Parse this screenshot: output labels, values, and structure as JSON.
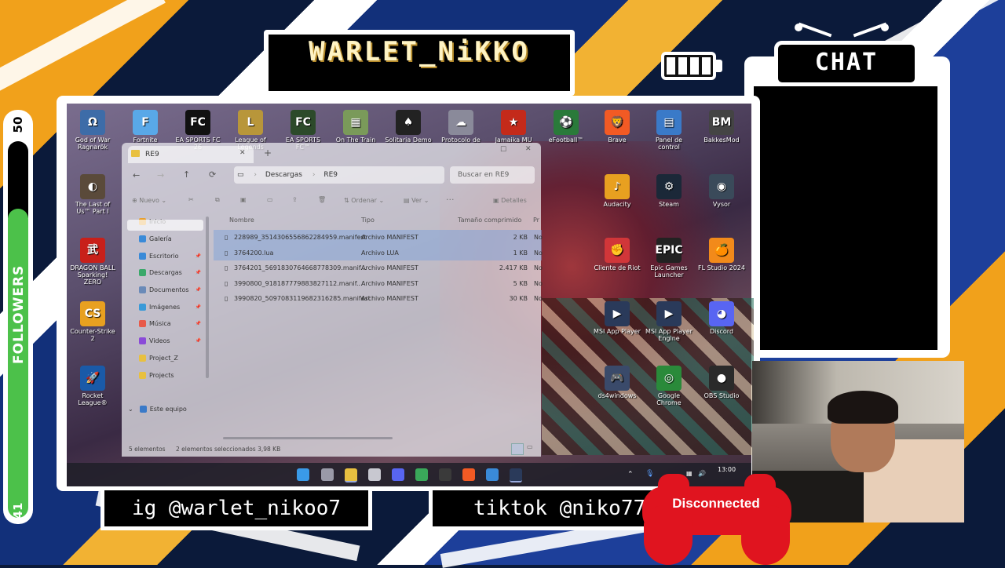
{
  "overlay": {
    "streamer_name": "WARLET_NiKKO",
    "chat_title": "CHAT",
    "followers_label": "FOLLOWERS",
    "followers_goal": "50",
    "followers_count": "41",
    "followers_progress": 0.82,
    "instagram": "ig @warlet_nikoo7",
    "tiktok": "tiktok @niko7789",
    "controller_status": "Disconnected",
    "colors": {
      "accent_green": "#4cc14a",
      "controller_red": "#e0141f",
      "frame": "#ffffff"
    }
  },
  "desktop": {
    "icons": [
      {
        "label": "God of War Ragnarök",
        "icon": "god-of-war-icon",
        "color": "#3d6ca8",
        "glyph": "Ω"
      },
      {
        "label": "Fortnite",
        "icon": "fortnite-icon",
        "color": "#59a8e8",
        "glyph": "F"
      },
      {
        "label": "EA SPORTS FC 26",
        "icon": "fc26-icon",
        "color": "#111111",
        "glyph": "FC"
      },
      {
        "label": "League of Legends",
        "icon": "league-icon",
        "color": "#b8963a",
        "glyph": "L"
      },
      {
        "label": "EA SPORTS FC™",
        "icon": "fc-icon",
        "color": "#2c4a2a",
        "glyph": "FC"
      },
      {
        "label": "On The Train",
        "icon": "on-the-train-icon",
        "color": "#7a9a5a",
        "glyph": "▦"
      },
      {
        "label": "Solitaria Demo",
        "icon": "solitaria-icon",
        "color": "#222222",
        "glyph": "♠"
      },
      {
        "label": "Protocolo de",
        "icon": "protocolo-icon",
        "color": "#8a8a9a",
        "glyph": "☁"
      },
      {
        "label": "Jamaika MU",
        "icon": "jamaika-icon",
        "color": "#c42a1a",
        "glyph": "★"
      },
      {
        "label": "eFootball™",
        "icon": "efootball-icon",
        "color": "#2a7a3a",
        "glyph": "⚽"
      },
      {
        "label": "Brave",
        "icon": "brave-icon",
        "color": "#f25a24",
        "glyph": "🦁"
      },
      {
        "label": "Panel de control",
        "icon": "control-panel-icon",
        "color": "#3a7ac8",
        "glyph": "▤"
      },
      {
        "label": "BakkesMod",
        "icon": "bakkesmod-icon",
        "color": "#444444",
        "glyph": "BM"
      },
      {
        "label": "The Last of Us™ Part I",
        "icon": "last-of-us-icon",
        "color": "#5a4a3a",
        "glyph": "◐"
      },
      {
        "label": "Audacity",
        "icon": "audacity-icon",
        "color": "#e8a020",
        "glyph": "♪"
      },
      {
        "label": "Steam",
        "icon": "steam-icon",
        "color": "#1b2838",
        "glyph": "⚙"
      },
      {
        "label": "Vysor",
        "icon": "vysor-icon",
        "color": "#3a4a5a",
        "glyph": "◉"
      },
      {
        "label": "DRAGON BALL Sparking! ZERO",
        "icon": "dragon-ball-icon",
        "color": "#c8201a",
        "glyph": "武"
      },
      {
        "label": "Cliente de Riot",
        "icon": "riot-client-icon",
        "color": "#d13639",
        "glyph": "✊"
      },
      {
        "label": "Epic Games Launcher",
        "icon": "epic-games-icon",
        "color": "#222222",
        "glyph": "EPIC"
      },
      {
        "label": "FL Studio 2024",
        "icon": "fl-studio-icon",
        "color": "#f28a1a",
        "glyph": "🍊"
      },
      {
        "label": "Counter-Strike 2",
        "icon": "counter-strike-icon",
        "color": "#e8a020",
        "glyph": "CS"
      },
      {
        "label": "MSI App Player",
        "icon": "msi-app-player-icon",
        "color": "#2a3a5a",
        "glyph": "▶"
      },
      {
        "label": "MSI App Player Engine",
        "icon": "msi-engine-icon",
        "color": "#2a3a5a",
        "glyph": "▶"
      },
      {
        "label": "Discord",
        "icon": "discord-icon",
        "color": "#5865f2",
        "glyph": "◕"
      },
      {
        "label": "Rocket League®",
        "icon": "rocket-league-icon",
        "color": "#1a5aa8",
        "glyph": "🚀"
      },
      {
        "label": "ds4windows",
        "icon": "ds4-icon",
        "color": "#3a4a6a",
        "glyph": "🎮"
      },
      {
        "label": "Google Chrome",
        "icon": "chrome-icon",
        "color": "#2a8a3a",
        "glyph": "◎"
      },
      {
        "label": "OBS Studio",
        "icon": "obs-icon",
        "color": "#2a2a2a",
        "glyph": "●"
      }
    ]
  },
  "explorer": {
    "tab_title": "RE9",
    "add_tab": "+",
    "breadcrumb": [
      "Descargas",
      "RE9"
    ],
    "search_placeholder": "Buscar en RE9",
    "toolbar": {
      "new": "Nuevo",
      "sort": "Ordenar",
      "view": "Ver",
      "more": "···",
      "details": "Detalles"
    },
    "nav": [
      {
        "label": "Inicio",
        "icon": "home-icon",
        "color": "#e8a030"
      },
      {
        "label": "Galería",
        "icon": "gallery-icon",
        "color": "#3a8ad8"
      },
      {
        "label": "Escritorio",
        "icon": "desktop-folder-icon",
        "color": "#3a8ad8"
      },
      {
        "label": "Descargas",
        "icon": "downloads-icon",
        "color": "#3aa86a"
      },
      {
        "label": "Documentos",
        "icon": "documents-icon",
        "color": "#6a8ab8"
      },
      {
        "label": "Imágenes",
        "icon": "pictures-icon",
        "color": "#3a9ad8"
      },
      {
        "label": "Música",
        "icon": "music-icon",
        "color": "#e85a4a"
      },
      {
        "label": "Videos",
        "icon": "videos-icon",
        "color": "#8a4ad8"
      },
      {
        "label": "Project_Z",
        "icon": "folder-icon",
        "color": "#e8c040"
      },
      {
        "label": "Projects",
        "icon": "folder-icon",
        "color": "#e8c040"
      },
      {
        "label": "",
        "icon": "",
        "color": "transparent"
      },
      {
        "label": "Este equipo",
        "icon": "this-pc-icon",
        "color": "#3a7ac8"
      }
    ],
    "columns": {
      "name": "Nombre",
      "type": "Tipo",
      "size": "Tamaño comprimido",
      "extra": "Pr"
    },
    "files": [
      {
        "name": "228989_3514306556862284959.manifest",
        "type": "Archivo MANIFEST",
        "size": "2 KB",
        "extra": "No",
        "selected": true
      },
      {
        "name": "3764200.lua",
        "type": "Archivo LUA",
        "size": "1 KB",
        "extra": "No",
        "selected": true
      },
      {
        "name": "3764201_5691830764668778309.manif...",
        "type": "Archivo MANIFEST",
        "size": "2.417 KB",
        "extra": "No",
        "selected": false
      },
      {
        "name": "3990800_918187779883827112.manif...",
        "type": "Archivo MANIFEST",
        "size": "5 KB",
        "extra": "No",
        "selected": false
      },
      {
        "name": "3990820_5097083119682316285.manifest",
        "type": "Archivo MANIFEST",
        "size": "30 KB",
        "extra": "No",
        "selected": false
      }
    ],
    "status": {
      "count": "5 elementos",
      "selection": "2 elementos seleccionados  3,98 KB"
    }
  },
  "taskbar": {
    "icons": [
      {
        "icon": "windows-start-icon",
        "color": "#3a9ae8"
      },
      {
        "icon": "task-view-icon",
        "color": "#9a9aa8"
      },
      {
        "icon": "file-explorer-icon",
        "color": "#e8c040"
      },
      {
        "icon": "store-icon",
        "color": "#c8c8d0"
      },
      {
        "icon": "discord-icon",
        "color": "#5865f2"
      },
      {
        "icon": "chrome-icon",
        "color": "#3aa85a"
      },
      {
        "icon": "obs-icon",
        "color": "#3a3a3a"
      },
      {
        "icon": "brave-icon",
        "color": "#f25a24"
      },
      {
        "icon": "photos-icon",
        "color": "#3a8ad8"
      },
      {
        "icon": "steam-icon",
        "color": "#2a3a5a"
      }
    ],
    "clock": "13:00"
  }
}
